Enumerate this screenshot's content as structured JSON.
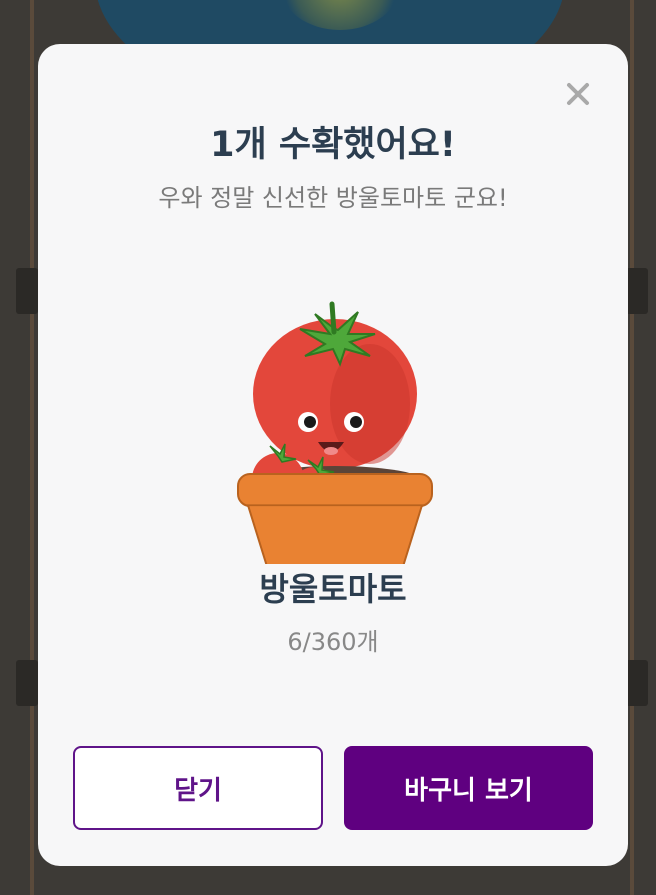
{
  "dialog": {
    "title": "1개 수확했어요!",
    "subtitle": "우와 정말 신선한 방울토마토 군요!",
    "item_name": "방울토마토",
    "item_count": "6/360개",
    "close_icon": "close-icon",
    "illustration": "cherry-tomato-in-pot-illustration"
  },
  "buttons": {
    "close_label": "닫기",
    "basket_label": "바구니 보기"
  },
  "colors": {
    "primary": "#5f0080",
    "title": "#2c3e50",
    "overlay": "#3d3a36",
    "dialog_bg": "#f7f7f8"
  }
}
